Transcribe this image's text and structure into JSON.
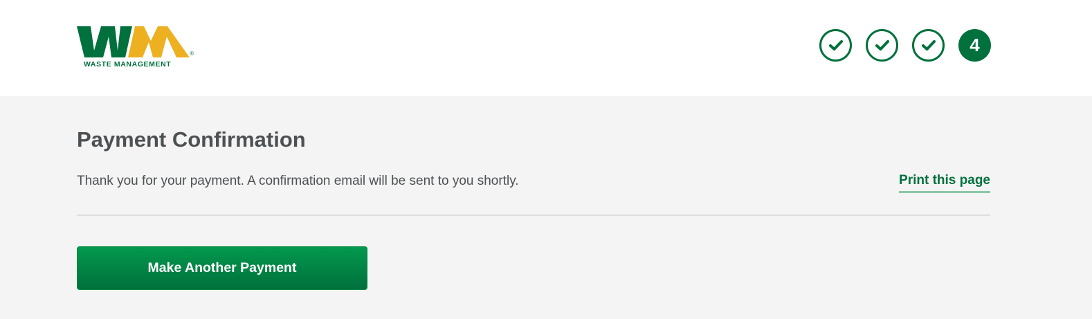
{
  "brand": {
    "logo_letters": "WM",
    "name": "WASTE MANAGEMENT",
    "trademark": "®",
    "colors": {
      "green": "#00703c",
      "gold": "#edb021",
      "text_gray": "#4d5154",
      "background": "#f4f4f4",
      "link_underline": "#8cc7a8"
    }
  },
  "progress": {
    "steps": [
      {
        "state": "complete",
        "icon": "checkmark-icon"
      },
      {
        "state": "complete",
        "icon": "checkmark-icon"
      },
      {
        "state": "complete",
        "icon": "checkmark-icon"
      },
      {
        "state": "current",
        "label": "4"
      }
    ]
  },
  "confirmation": {
    "title": "Payment Confirmation",
    "message": "Thank you for your payment. A confirmation email will be sent to you shortly.",
    "print_link": "Print this page"
  },
  "actions": {
    "make_another_payment": "Make Another Payment"
  }
}
